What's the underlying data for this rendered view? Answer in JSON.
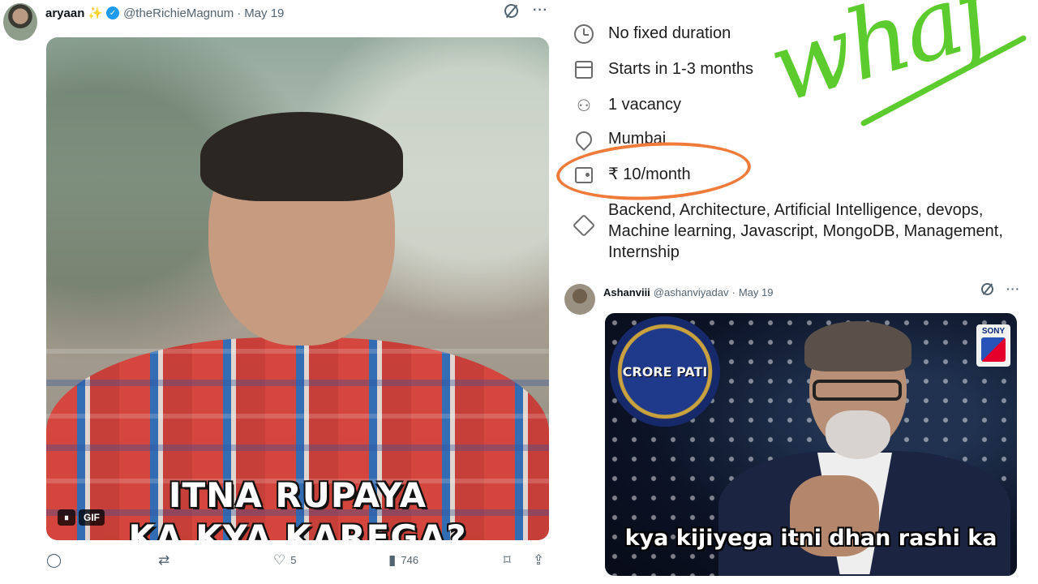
{
  "left_tweet": {
    "display_name": "aryaan",
    "name_emoji": "✨",
    "handle": "@theRichieMagnum",
    "separator": "·",
    "date": "May 19",
    "more": "···",
    "gif": {
      "caption_line1": "ITNA RUPAYA",
      "caption_line2": "KA KYA KAREGA?",
      "pause_symbol": "⏸",
      "badge": "GIF"
    },
    "actions": {
      "reply_icon": "reply-icon",
      "retweet_icon": "retweet-icon",
      "like_count": "5",
      "views_count": "746",
      "bookmark_icon": "bookmark-icon",
      "share_icon": "share-icon"
    }
  },
  "job_card": {
    "duration": "No fixed duration",
    "start": "Starts in 1-3 months",
    "vacancy": "1 vacancy",
    "location": "Mumbai",
    "stipend": "₹ 10/month",
    "skills": "Backend, Architecture, Artificial Intelligence, devops, Machine learning, Javascript, MongoDB, Management, Internship",
    "annotation": {
      "scribble": "whaf",
      "oval_color": "#f07a3a",
      "scribble_color": "#5ccb2e"
    }
  },
  "right_tweet": {
    "display_name": "Ashanviii",
    "handle": "@ashanviyadav",
    "separator": "·",
    "date": "May 19",
    "more": "···",
    "media": {
      "logo_text": "CRORE PATI",
      "channel_text": "SONY",
      "subtitle": "kya kijiyega itni dhan rashi ka"
    }
  },
  "colors": {
    "verified": "#1d9bf0",
    "muted_text": "#536471",
    "primary_text": "#0f1419"
  }
}
